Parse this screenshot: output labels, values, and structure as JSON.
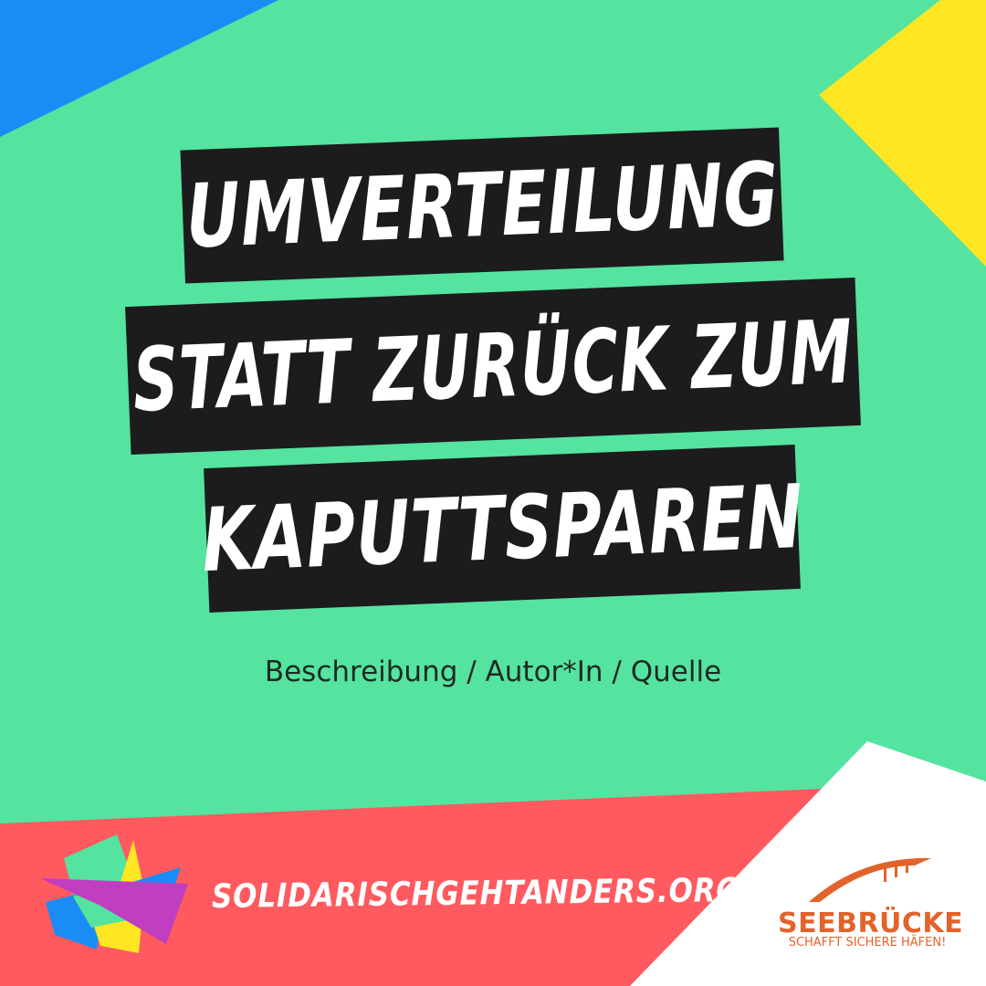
{
  "headline": {
    "line1": "UMVERTEILUNG",
    "line2": "STATT ZURÜCK ZUM",
    "line3": "KAPUTTSPAREN"
  },
  "subtitle": "Beschreibung / Autor*In / Quelle",
  "footer": {
    "url": "SOLIDARISCHGEHTANDERS.ORG",
    "seebruecke_logo": {
      "wordmark": "SEEBRÜCKE",
      "tagline": "SCHAFFT SICHERE HÄFEN!"
    }
  },
  "colors": {
    "background": "#55e3a0",
    "headline_box": "#1c1c1c",
    "headline_text": "#ffffff",
    "corner_blue": "#1a8cf5",
    "corner_yellow": "#ffe623",
    "footer_red": "#ff5a5f",
    "footer_white": "#ffffff",
    "seebruecke_orange": "#e2632a"
  }
}
